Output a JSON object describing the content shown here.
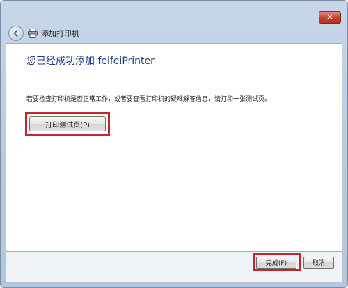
{
  "window": {
    "close_glyph": "✕"
  },
  "nav": {
    "title": "添加打印机",
    "back_icon": "back-arrow-icon",
    "printer_icon": "printer-icon"
  },
  "main": {
    "heading": "您已经成功添加 feifeiPrinter",
    "description": "若要检查打印机是否正常工作，或者要查看打印机的疑难解答信息，请打印一张测试页。",
    "print_test_button": "打印测试页(P)"
  },
  "footer": {
    "finish_button": "完成(F)",
    "cancel_button": "取消"
  },
  "colors": {
    "heading": "#1e3b87",
    "highlight": "#c4262b",
    "frame": "#b7c9df"
  }
}
